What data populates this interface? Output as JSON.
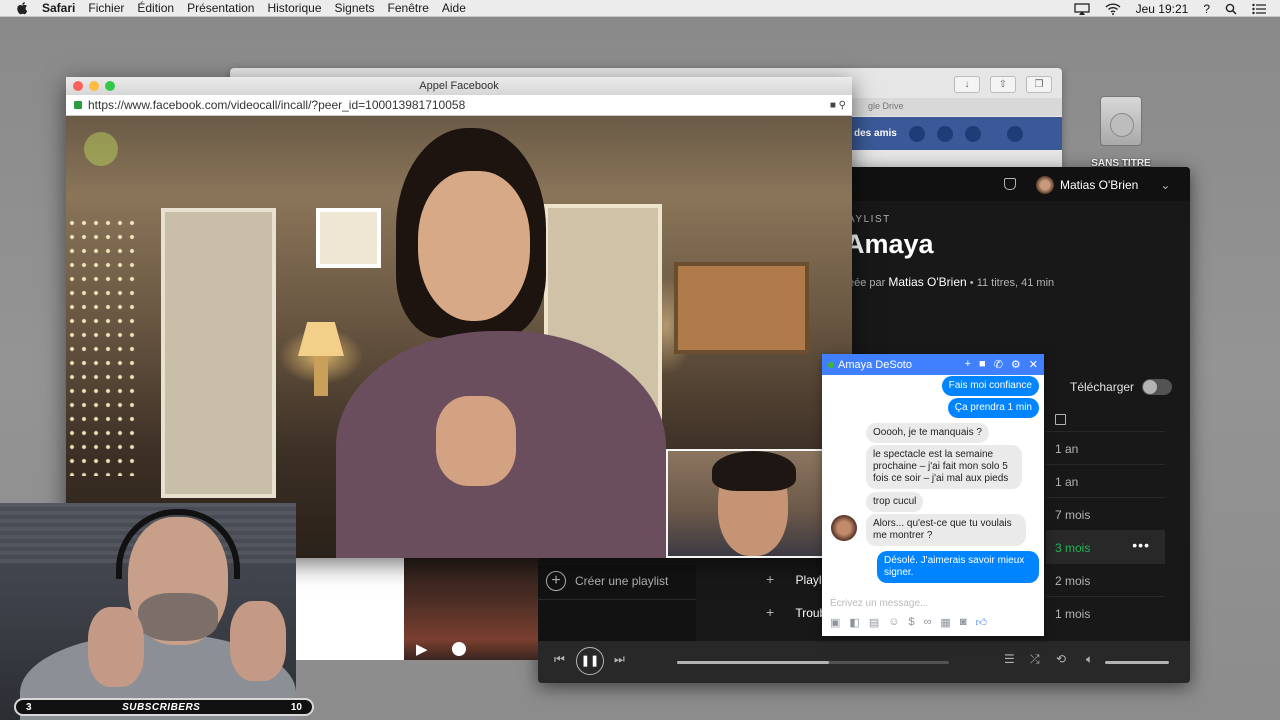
{
  "menubar": {
    "app": "Safari",
    "items": [
      "Fichier",
      "Édition",
      "Présentation",
      "Historique",
      "Signets",
      "Fenêtre",
      "Aide"
    ],
    "clock": "Jeu 19:21",
    "help": "?"
  },
  "desktop": {
    "disk_label": "SANS TITRE"
  },
  "background_browser": {
    "tab_label": "gle Drive",
    "fb_nav_label": "des amis"
  },
  "fbcall": {
    "window_title": "Appel Facebook",
    "url": "https://www.facebook.com/videocall/incall/?peer_id=100013981710058"
  },
  "spotify": {
    "user_name": "Matias O'Brien",
    "kicker": "AYLIST",
    "playlist_title": "Amaya",
    "created_by_prefix": "éée par",
    "owner": "Matias O'Brien",
    "stats": "11 titres, 41 min",
    "download_label": "Télécharger",
    "dates": [
      "1 an",
      "1 an",
      "7 mois",
      "3 mois",
      "2 mois",
      "1 mois"
    ],
    "active_date_index": 3,
    "more_label": "•••",
    "create_playlist": "Créer une playlist",
    "tracks": [
      "Playli",
      "Troub"
    ],
    "progress": 0.56
  },
  "chat": {
    "contact": "Amaya DeSoto",
    "messages": [
      {
        "from": "me",
        "text": "Fais moi confiance"
      },
      {
        "from": "me",
        "text": "Ça prendra 1 min"
      },
      {
        "from": "them",
        "text": "Ooooh, je te manquais ?"
      },
      {
        "from": "them",
        "text": "le spectacle est la semaine prochaine – j'ai fait mon solo 5 fois ce soir – j'ai mal aux pieds"
      },
      {
        "from": "them",
        "text": "trop cucul"
      },
      {
        "from": "them",
        "text": "Alors... qu'est-ce que tu voulais me montrer ?"
      },
      {
        "from": "me",
        "text": "Désolé. J'aimerais savoir mieux signer."
      }
    ],
    "input_placeholder": "Écrivez un message..."
  },
  "stream_overlay": {
    "left_count": "3",
    "label": "SUBSCRIBERS",
    "right_count": "10"
  }
}
